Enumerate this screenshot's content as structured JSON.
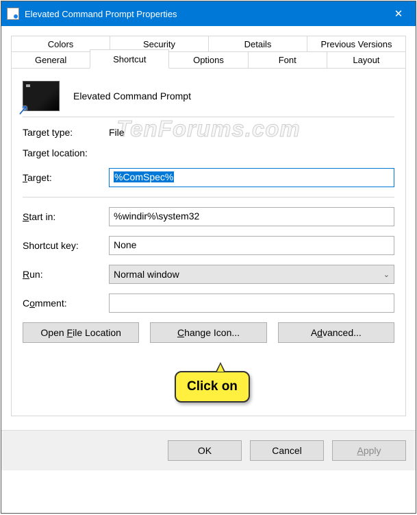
{
  "window": {
    "title": "Elevated Command Prompt Properties"
  },
  "tabs": {
    "row1": [
      "Colors",
      "Security",
      "Details",
      "Previous Versions"
    ],
    "row2": [
      "General",
      "Shortcut",
      "Options",
      "Font",
      "Layout"
    ],
    "active": "Shortcut"
  },
  "header": {
    "name": "Elevated Command Prompt"
  },
  "fields": {
    "target_type_label": "Target type:",
    "target_type_value": "File",
    "target_location_label": "Target location:",
    "target_location_value": "",
    "target_label_pre": "T",
    "target_label_post": "arget:",
    "target_value": "%ComSpec%",
    "startin_label_pre": "S",
    "startin_label_post": "tart in:",
    "startin_value": "%windir%\\system32",
    "shortcutkey_label": "Shortcut key:",
    "shortcutkey_value": "None",
    "run_label_pre": "R",
    "run_label_post": "un:",
    "run_value": "Normal window",
    "comment_label_pre": "C",
    "comment_label_post": "omment:",
    "comment_value": ""
  },
  "buttons": {
    "open_file_pre": "Open ",
    "open_file_u": "F",
    "open_file_post": "ile Location",
    "change_icon_pre": "",
    "change_icon_u": "C",
    "change_icon_post": "hange Icon...",
    "advanced_pre": "A",
    "advanced_u": "d",
    "advanced_post": "vanced...",
    "ok": "OK",
    "cancel": "Cancel",
    "apply": "Apply"
  },
  "watermark": "TenForums.com",
  "callout": "Click on"
}
